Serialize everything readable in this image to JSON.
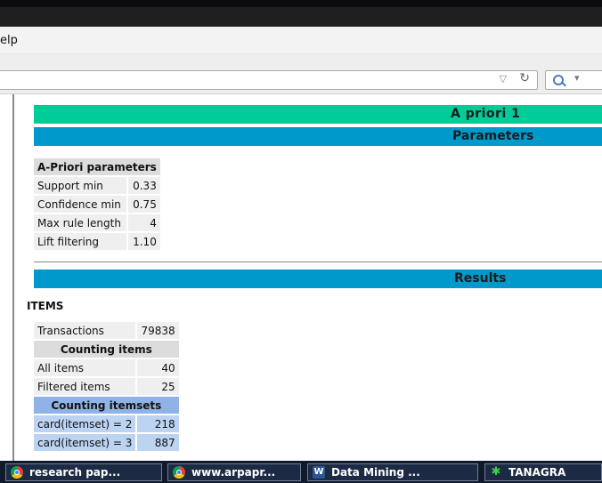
{
  "menu": {
    "help_fragment": "elp"
  },
  "page": {
    "title_bar": "A priori 1",
    "parameters_bar": "Parameters",
    "results_bar": "Results",
    "parameters_table": {
      "header": "A-Priori parameters",
      "rows": [
        {
          "label": "Support min",
          "value": "0.33"
        },
        {
          "label": "Confidence min",
          "value": "0.75"
        },
        {
          "label": "Max rule length",
          "value": "4"
        },
        {
          "label": "Lift filtering",
          "value": "1.10"
        }
      ]
    },
    "items_label": "ITEMS",
    "results_table": {
      "transactions_label": "Transactions",
      "transactions_value": "79838",
      "counting_items_header": "Counting items",
      "all_items_label": "All items",
      "all_items_value": "40",
      "filtered_items_label": "Filtered items",
      "filtered_items_value": "25",
      "counting_itemsets_header": "Counting itemsets",
      "itemsets": [
        {
          "label": "card(itemset) = 2",
          "value": "218"
        },
        {
          "label": "card(itemset) = 3",
          "value": "887"
        }
      ]
    }
  },
  "taskbar": {
    "items": [
      {
        "label": "research pap...",
        "icon": "chrome-icon"
      },
      {
        "label": "www.arpapr...",
        "icon": "chrome-icon"
      },
      {
        "label": "Data Mining ...",
        "icon": "word-icon"
      },
      {
        "label": "TANAGRA",
        "icon": "tanagra-palm-icon"
      }
    ]
  },
  "colors": {
    "title_bar": "#00cc99",
    "section_bar": "#0099cc",
    "itemsets_header": "#8fb3e6"
  }
}
